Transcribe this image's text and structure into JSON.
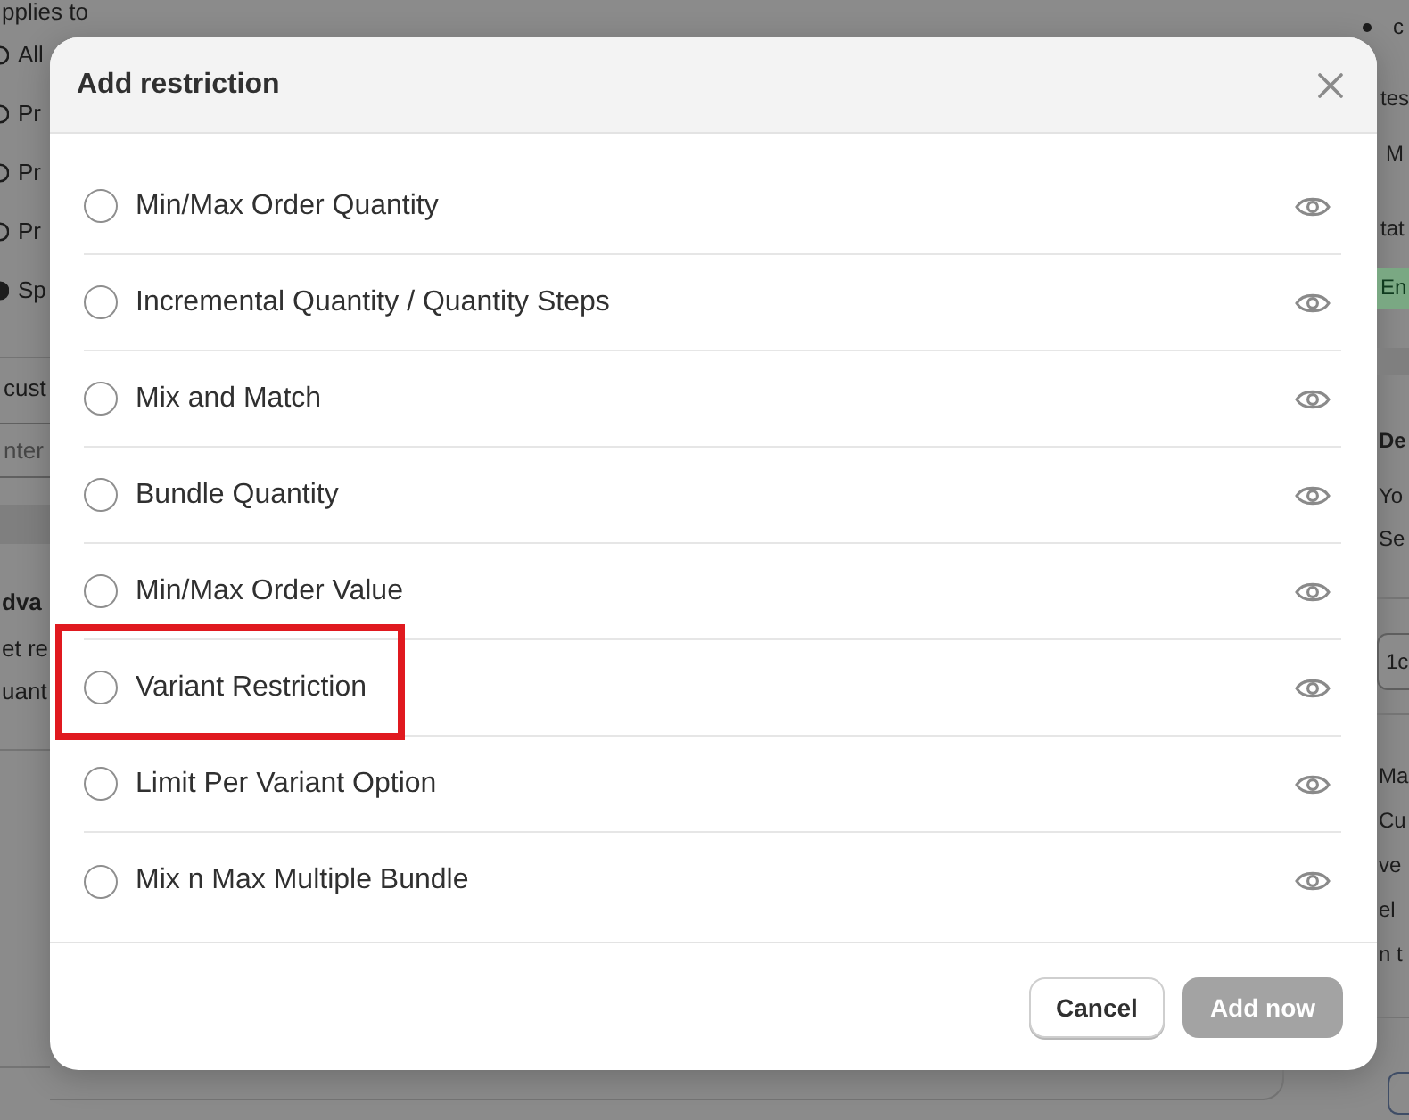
{
  "background": {
    "left_panel": {
      "heading": "pplies to",
      "radio_options": [
        {
          "label": "All",
          "selected": false
        },
        {
          "label": "Pr",
          "selected": false
        },
        {
          "label": "Pr",
          "selected": false
        },
        {
          "label": "Pr",
          "selected": false
        },
        {
          "label": "Sp",
          "selected": true
        }
      ],
      "field_label": "cust",
      "field": {
        "placeholder": "nter"
      },
      "section_title": "dva",
      "section_lines": [
        "et re",
        "uant"
      ]
    },
    "right_panel": {
      "bullet_item": "c",
      "label_1": "tes",
      "value_1": "M",
      "label_2": "tat",
      "badge": "En",
      "card_title": "De",
      "card_lines": [
        "Yo",
        "Se"
      ],
      "field": {
        "value": "1c"
      },
      "paragraph_lines": [
        "Ma",
        "Cu",
        "ve",
        "el",
        "n t"
      ]
    }
  },
  "dialog": {
    "title": "Add restriction",
    "options": [
      {
        "label": "Min/Max Order Quantity",
        "selected": false,
        "highlighted": false
      },
      {
        "label": "Incremental Quantity / Quantity Steps",
        "selected": false,
        "highlighted": false
      },
      {
        "label": "Mix and Match",
        "selected": false,
        "highlighted": false
      },
      {
        "label": "Bundle Quantity",
        "selected": false,
        "highlighted": false
      },
      {
        "label": "Min/Max Order Value",
        "selected": false,
        "highlighted": false
      },
      {
        "label": "Variant Restriction",
        "selected": false,
        "highlighted": true
      },
      {
        "label": "Limit Per Variant Option",
        "selected": false,
        "highlighted": false
      },
      {
        "label": "Mix n Max Multiple Bundle",
        "selected": false,
        "highlighted": false
      }
    ],
    "buttons": [
      {
        "label": "Cancel",
        "kind": "secondary",
        "disabled": false
      },
      {
        "label": "Add now",
        "kind": "primary",
        "disabled": true
      }
    ]
  }
}
